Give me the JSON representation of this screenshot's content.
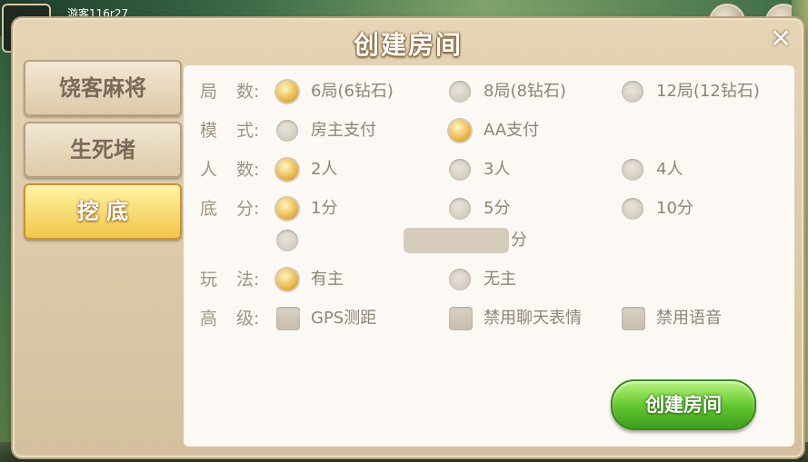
{
  "background": {
    "username": "游客116r27"
  },
  "dialog": {
    "title": "创建房间",
    "close_label": "✕",
    "create_button_label": "创建房间"
  },
  "tabs": [
    {
      "label": "饶客麻将",
      "active": false
    },
    {
      "label": "生死堵",
      "active": false
    },
    {
      "label": "挖  底",
      "active": true
    }
  ],
  "rounds": {
    "label_a": "局",
    "label_b": "数:",
    "options": [
      {
        "text": "6局(6钻石)",
        "checked": true
      },
      {
        "text": "8局(8钻石)",
        "checked": false
      },
      {
        "text": "12局(12钻石)",
        "checked": false
      }
    ]
  },
  "mode": {
    "label_a": "模",
    "label_b": "式:",
    "options": [
      {
        "text": "房主支付",
        "checked": false
      },
      {
        "text": "AA支付",
        "checked": true
      }
    ]
  },
  "players": {
    "label_a": "人",
    "label_b": "数:",
    "options": [
      {
        "text": "2人",
        "checked": true
      },
      {
        "text": "3人",
        "checked": false
      },
      {
        "text": "4人",
        "checked": false
      }
    ]
  },
  "base_score": {
    "label_a": "底",
    "label_b": "分:",
    "options": [
      {
        "text": "1分",
        "checked": true
      },
      {
        "text": "5分",
        "checked": false
      },
      {
        "text": "10分",
        "checked": false
      }
    ],
    "custom_value": "",
    "custom_unit": "分"
  },
  "play_style": {
    "label_a": "玩",
    "label_b": "法:",
    "options": [
      {
        "text": "有主",
        "checked": true
      },
      {
        "text": "无主",
        "checked": false
      }
    ]
  },
  "advanced": {
    "label_a": "高",
    "label_b": "级:",
    "options": [
      {
        "text": "GPS测距",
        "checked": false
      },
      {
        "text": "禁用聊天表情",
        "checked": false
      },
      {
        "text": "禁用语音",
        "checked": false
      }
    ]
  },
  "colors": {
    "accent_gold": "#f2c64a",
    "button_green": "#5fc52e",
    "panel_bg": "#fcf8f3",
    "text_muted": "#8e8579"
  }
}
